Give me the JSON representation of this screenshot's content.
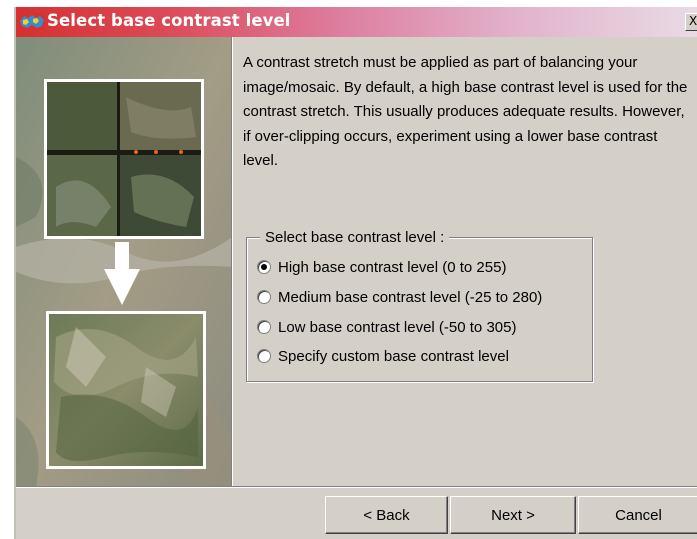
{
  "window": {
    "title": "Select base contrast level",
    "close_glyph": "X"
  },
  "intro_text": "A contrast stretch must be applied as part of balancing your image/mosaic.  By default, a high base contrast level is used for the contrast stretch.  This usually produces adequate results.  However, if over-clipping occurs, experiment using a lower base contrast level.",
  "group": {
    "title": "Select base contrast level :",
    "options": [
      {
        "label": "High base contrast level (0 to 255)",
        "selected": true
      },
      {
        "label": "Medium base contrast level (-25 to 280)",
        "selected": false
      },
      {
        "label": "Low base contrast level (-50 to 305)",
        "selected": false
      },
      {
        "label": "Specify custom base contrast level",
        "selected": false
      }
    ]
  },
  "buttons": {
    "back": "< Back",
    "next": "Next >",
    "cancel": "Cancel"
  },
  "icons": {
    "title": "app-map-icon",
    "arrow": "down-arrow-icon"
  },
  "colors": {
    "dialog_bg": "#d4d0c8",
    "title_start": "#d63030",
    "title_end": "#e9dbe5"
  }
}
